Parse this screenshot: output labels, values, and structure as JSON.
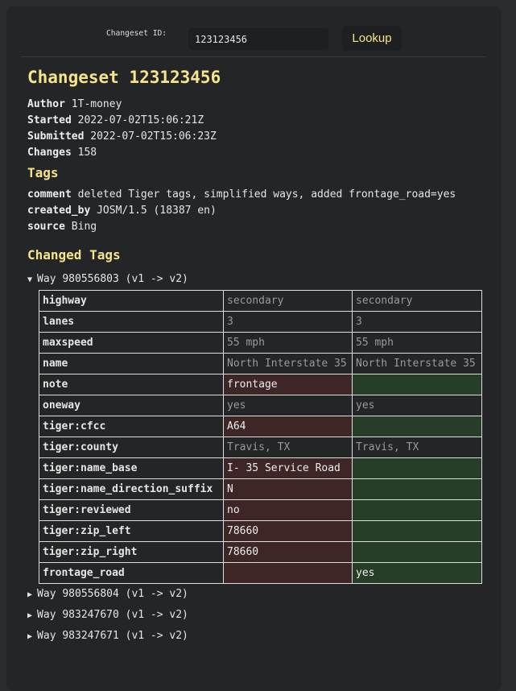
{
  "lookup": {
    "label": "Changeset ID:",
    "value": "123123456",
    "button": "Lookup"
  },
  "title": "Changeset 123123456",
  "meta": [
    {
      "k": "Author",
      "v": "1T-money"
    },
    {
      "k": "Started",
      "v": "2022-07-02T15:06:21Z"
    },
    {
      "k": "Submitted",
      "v": "2022-07-02T15:06:23Z"
    },
    {
      "k": "Changes",
      "v": "158"
    }
  ],
  "tags_heading": "Tags",
  "tags": [
    {
      "k": "comment",
      "v": "deleted Tiger tags, simplified ways, added frontage_road=yes"
    },
    {
      "k": "created_by",
      "v": "JOSM/1.5 (18387 en)"
    },
    {
      "k": "source",
      "v": "Bing"
    }
  ],
  "changed_heading": "Changed Tags",
  "colors": {
    "accent": "#f5e58a",
    "removed": "#3e2526",
    "added": "#263d27"
  },
  "ways": [
    {
      "label": "Way 980556803 (v1 -> v2)",
      "expanded": true,
      "rows": [
        {
          "k": "highway",
          "old": "secondary",
          "new": "secondary",
          "s": "same"
        },
        {
          "k": "lanes",
          "old": "3",
          "new": "3",
          "s": "same"
        },
        {
          "k": "maxspeed",
          "old": "55 mph",
          "new": "55 mph",
          "s": "same"
        },
        {
          "k": "name",
          "old": "North Interstate 35",
          "new": "North Interstate 35",
          "s": "same"
        },
        {
          "k": "note",
          "old": "frontage",
          "new": "",
          "s": "removed"
        },
        {
          "k": "oneway",
          "old": "yes",
          "new": "yes",
          "s": "same"
        },
        {
          "k": "tiger:cfcc",
          "old": "A64",
          "new": "",
          "s": "removed"
        },
        {
          "k": "tiger:county",
          "old": "Travis, TX",
          "new": "Travis, TX",
          "s": "same"
        },
        {
          "k": "tiger:name_base",
          "old": "I- 35 Service Road",
          "new": "",
          "s": "removed"
        },
        {
          "k": "tiger:name_direction_suffix",
          "old": "N",
          "new": "",
          "s": "removed"
        },
        {
          "k": "tiger:reviewed",
          "old": "no",
          "new": "",
          "s": "removed"
        },
        {
          "k": "tiger:zip_left",
          "old": "78660",
          "new": "",
          "s": "removed"
        },
        {
          "k": "tiger:zip_right",
          "old": "78660",
          "new": "",
          "s": "removed"
        },
        {
          "k": "frontage_road",
          "old": "",
          "new": "yes",
          "s": "added"
        }
      ]
    },
    {
      "label": "Way 980556804 (v1 -> v2)",
      "expanded": false
    },
    {
      "label": "Way 983247670 (v1 -> v2)",
      "expanded": false
    },
    {
      "label": "Way 983247671 (v1 -> v2)",
      "expanded": false
    }
  ]
}
